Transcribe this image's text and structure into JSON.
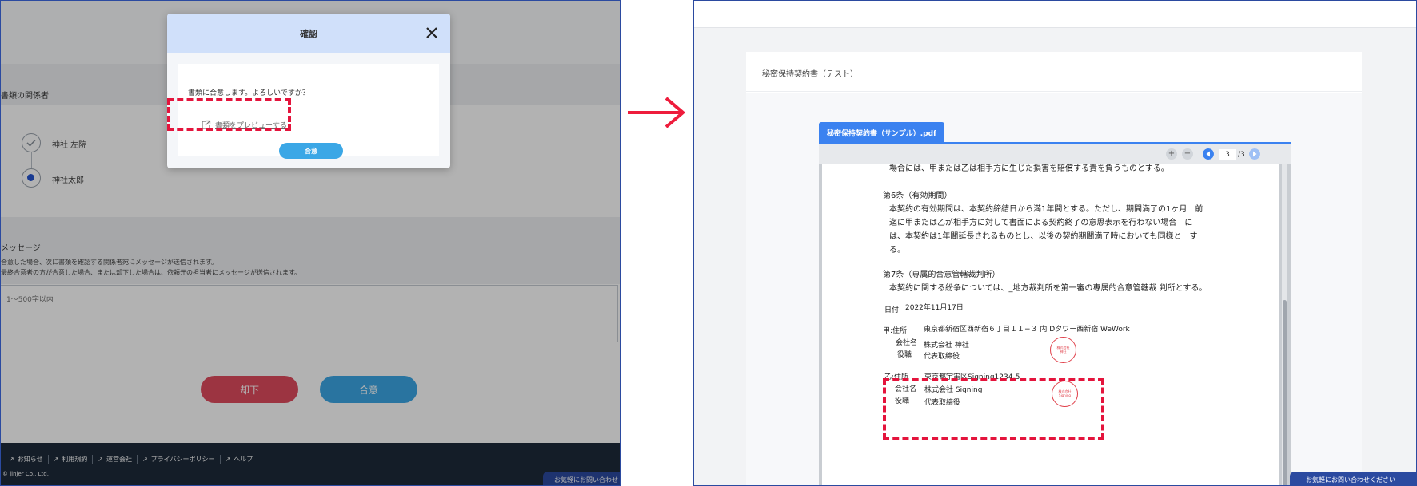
{
  "left_screen": {
    "section_parties_title": "書類の関係者",
    "parties": [
      {
        "name": "神社 左院",
        "state": "done"
      },
      {
        "name": "神社太郎",
        "state": "current"
      }
    ],
    "message_section_title": "メッセージ",
    "message_notes": [
      "合意した場合、次に書類を確認する関係者宛にメッセージが送信されます。",
      "最終合意者の方が合意した場合、または却下した場合は、依頼元の担当者にメッセージが送信されます。"
    ],
    "message_placeholder": "1〜500字以内",
    "reject_button": "却下",
    "approve_button": "合意",
    "footer_links": [
      "お知らせ",
      "利用規約",
      "運営会社",
      "プライバシーポリシー",
      "ヘルプ"
    ],
    "copyright": "© jinjer Co., Ltd.",
    "contact_button": "お気軽にお問い合わせ",
    "modal": {
      "title": "確認",
      "message": "書類に合意します。よろしいですか？",
      "preview_link": "書類をプレビューする",
      "agree_button": "合意"
    }
  },
  "right_screen": {
    "document_title": "秘密保持契約書（テスト）",
    "file_tab": "秘密保持契約書（サンプル）.pdf",
    "toolbar": {
      "current_page": "3",
      "total_pages": "/3"
    },
    "page_lines": {
      "top_cut": "場合には、甲または乙は相手方に生じた損害を賠償する責を負うものとする。",
      "art6_title": "第6条（有効期間）",
      "art6_l1": "本契約の有効期間は、本契約締結日から満1年間とする。ただし、期間満了の1ヶ月　前",
      "art6_l2": "迄に甲または乙が相手方に対して書面による契約終了の意思表示を行わない場合　に",
      "art6_l3": "は、本契約は1年間延長されるものとし、以後の契約期間満了時においても同様と　す",
      "art6_l4": "る。",
      "art7_title": "第7条（専属的合意管轄裁判所）",
      "art7_l1": "本契約に関する紛争については、_地方裁判所を第一審の専属的合意管轄裁 判所とする。",
      "date_label": "日付:",
      "date_value": "2022年11月17日",
      "party_a": {
        "label_address": "甲:住所",
        "address": "東京都新宿区西新宿６丁目１１−３ 内 Dタワー西新宿 WeWork",
        "label_company": "会社名",
        "company": "株式会社 神社",
        "label_role": "役職",
        "role": "代表取締役",
        "seal": [
          "株式会社",
          "神社"
        ]
      },
      "party_b": {
        "label_address": "乙:住所",
        "address": "東京都宇宙区Signing1234-5",
        "label_company": "会社名",
        "company": "株式会社 Signing",
        "label_role": "役職",
        "role": "代表取締役",
        "seal": [
          "株式会社",
          "Signing"
        ]
      }
    },
    "contact_button": "お気軽にお問い合わせください"
  },
  "colors": {
    "accent_blue": "#3b82f0",
    "reject_red": "#e04b5e",
    "approve_blue": "#3ba7e6",
    "highlight_red": "#e4143c",
    "arrow_red": "#ee1c3c",
    "footer_dark": "#1d2a3a",
    "contact_navy": "#2b4aa0"
  }
}
